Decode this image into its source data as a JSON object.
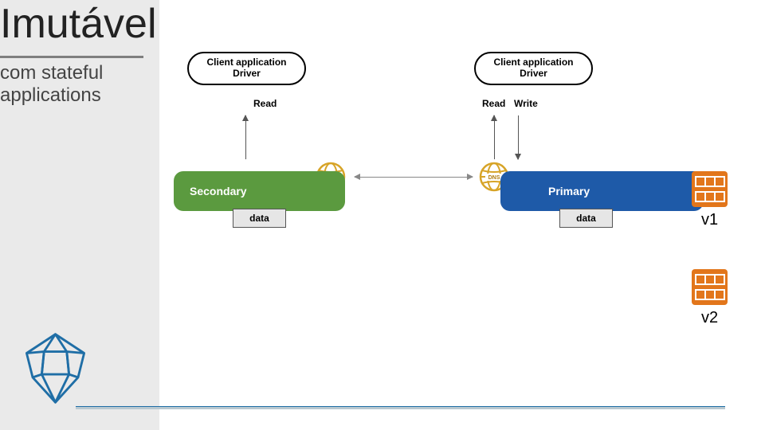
{
  "title": "Imutável",
  "subtitle_line1": "com stateful",
  "subtitle_line2": "applications",
  "client_left_line1": "Client application",
  "client_left_line2": "Driver",
  "client_right_line1": "Client application",
  "client_right_line2": "Driver",
  "label_read_left": "Read",
  "label_read_right": "Read",
  "label_write_right": "Write",
  "db_secondary": "Secondary",
  "db_primary": "Primary",
  "data_tag_left": "data",
  "data_tag_right": "data",
  "dns_label": "DNS",
  "server_v1": "v1",
  "server_v2": "v2"
}
